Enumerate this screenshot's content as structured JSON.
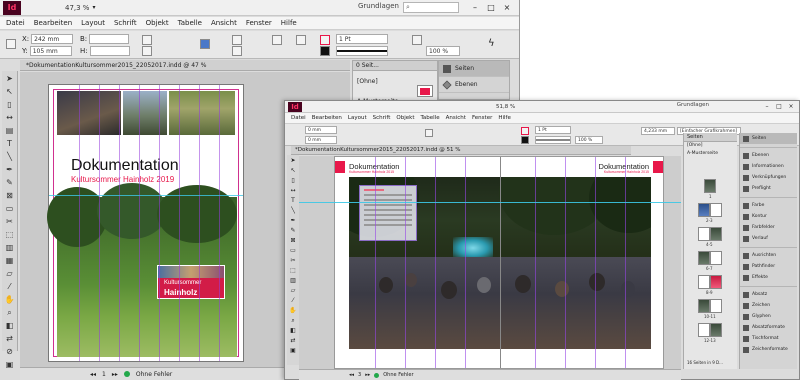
{
  "window_back": {
    "app_logo": "Id",
    "zoom": "47,3 %",
    "workspace": "Grundlagen",
    "search_placeholder": "",
    "menu": [
      "Datei",
      "Bearbeiten",
      "Layout",
      "Schrift",
      "Objekt",
      "Tabelle",
      "Ansicht",
      "Fenster",
      "Hilfe"
    ],
    "control": {
      "x_label": "X:",
      "x_value": "242 mm",
      "y_label": "Y:",
      "y_value": "105 mm",
      "w_label": "B:",
      "h_label": "H:",
      "stroke_weight": "1 Pt",
      "opacity": "100 %"
    },
    "doc_tab": "*DokumentationKultursommer2015_22052017.indd @ 47 %",
    "page": {
      "title": "Dokumentation",
      "subtitle": "Kultursommer Hainholz 2019",
      "banner_line1": "Kultursommer",
      "banner_line2": "Hainholz"
    },
    "status": "Ohne Fehler",
    "pages_panel": {
      "tab": "0 Seit...",
      "row_none": "[Ohne]",
      "row_master": "A-Musterseite"
    },
    "dock": [
      "Seiten",
      "Ebenen"
    ]
  },
  "window_front": {
    "app_logo": "Id",
    "zoom": "51,8 %",
    "workspace": "Grundlagen",
    "menu": [
      "Datei",
      "Bearbeiten",
      "Layout",
      "Schrift",
      "Objekt",
      "Tabelle",
      "Ansicht",
      "Fenster",
      "Hilfe"
    ],
    "control": {
      "x_value": "0 mm",
      "y_value": "0 mm",
      "stroke_weight": "1 Pt",
      "opacity": "100 %",
      "value_mm": "4,233 mm",
      "frame_label": "[Einfacher Grafikrahmen]"
    },
    "doc_tab": "*DokumentationKultursommer2015_22052017.indd @ 51 %",
    "spread": {
      "title_left": "Dokumentation",
      "subtitle_left": "Kultursommer Hainholz 2015",
      "title_right": "Dokumentation",
      "subtitle_right": "Kultursommer Hainholz 2015"
    },
    "status": "Ohne Fehler",
    "pages_panel": {
      "tab": "Seiten",
      "row_none": "[Ohne]",
      "row_master": "A-Musterseite",
      "labels": [
        "1",
        "2-3",
        "4-5",
        "6-7",
        "8-9",
        "10-11",
        "12-13"
      ],
      "footer": "16 Seiten in 9 D..."
    },
    "dock": [
      "Seiten",
      "Ebenen",
      "Informationen",
      "Verknüpfungen",
      "Preflight",
      "Farbe",
      "Kontur",
      "Farbfelder",
      "Verlauf",
      "Ausrichten",
      "Pathfinder",
      "Effekte",
      "Absatz",
      "Zeichen",
      "Glyphen",
      "Absatzformate",
      "Tischformat",
      "Zeichenformate"
    ]
  }
}
